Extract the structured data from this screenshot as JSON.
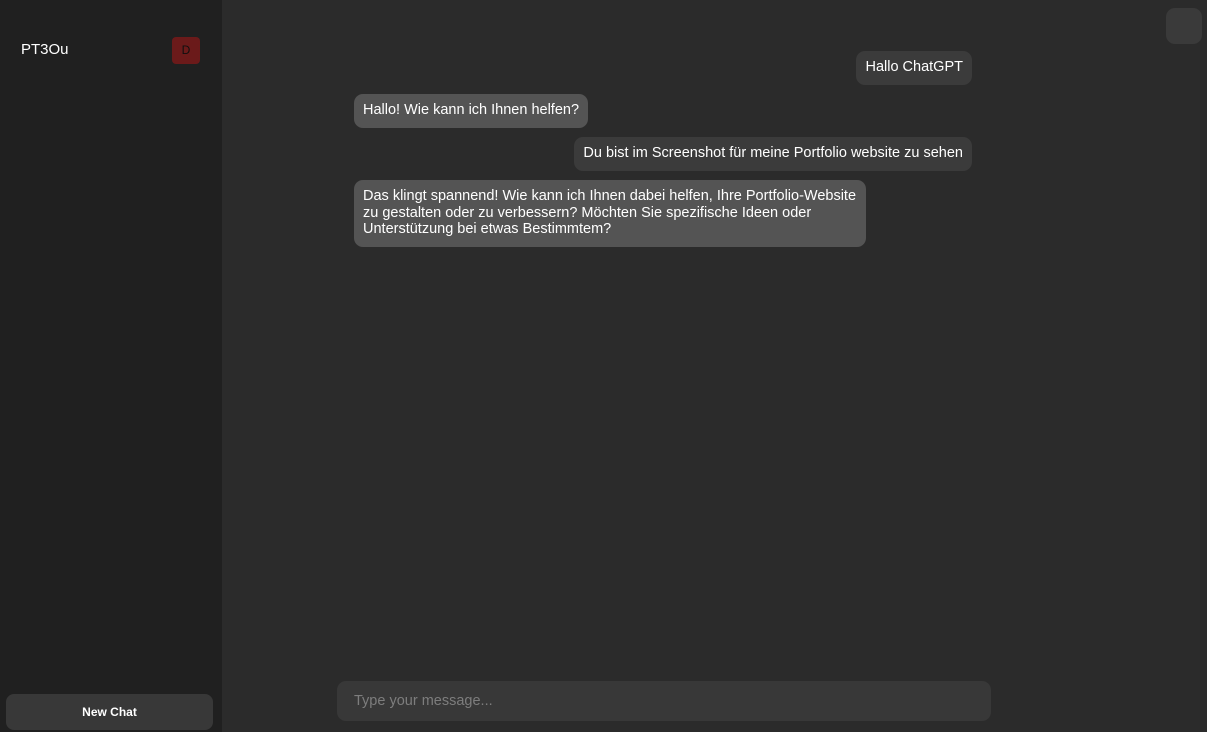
{
  "sidebar": {
    "chats": [
      {
        "title": "PT3Ou",
        "delete_label": "D"
      }
    ],
    "new_chat_label": "New Chat"
  },
  "main": {
    "messages": [
      {
        "role": "user",
        "text": "Hallo ChatGPT"
      },
      {
        "role": "assistant",
        "text": "Hallo! Wie kann ich Ihnen helfen?"
      },
      {
        "role": "user",
        "text": "Du bist im Screenshot für meine Portfolio website zu sehen"
      },
      {
        "role": "assistant",
        "text": "Das klingt spannend! Wie kann ich Ihnen dabei helfen, Ihre Portfolio-Website zu gestalten oder zu verbessern? Möchten Sie spezifische Ideen oder Unterstützung bei etwas Bestimmtem?"
      }
    ],
    "input": {
      "value": "",
      "placeholder": "Type your message..."
    }
  },
  "colors": {
    "sidebar_bg": "#202020",
    "main_bg": "#2b2b2b",
    "user_bubble": "#3b3b3b",
    "assistant_bubble": "#545454",
    "delete_button": "#6b1a1a"
  }
}
